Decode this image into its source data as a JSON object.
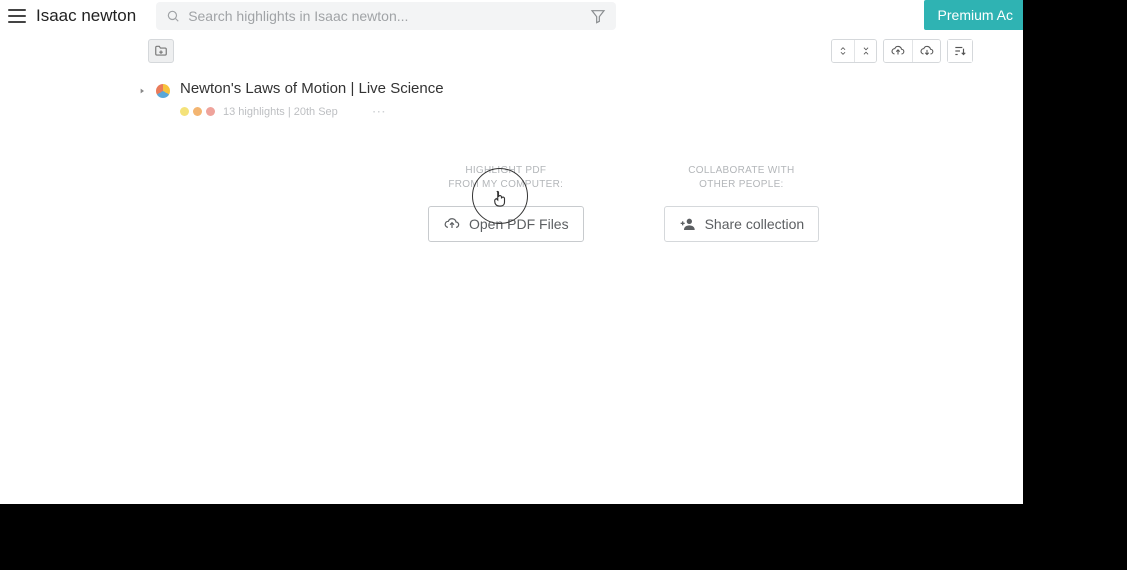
{
  "header": {
    "title": "Isaac newton",
    "search_placeholder": "Search highlights in Isaac newton...",
    "premium_label": "Premium Ac"
  },
  "item": {
    "title": "Newton's Laws of Motion | Live Science",
    "subtext": "13 highlights | 20th Sep"
  },
  "actions": {
    "pdf_label_line1": "HIGHLIGHT PDF",
    "pdf_label_line2": "FROM MY COMPUTER:",
    "pdf_button": "Open PDF Files",
    "collab_label_line1": "COLLABORATE WITH",
    "collab_label_line2": "OTHER PEOPLE:",
    "collab_button": "Share collection"
  }
}
